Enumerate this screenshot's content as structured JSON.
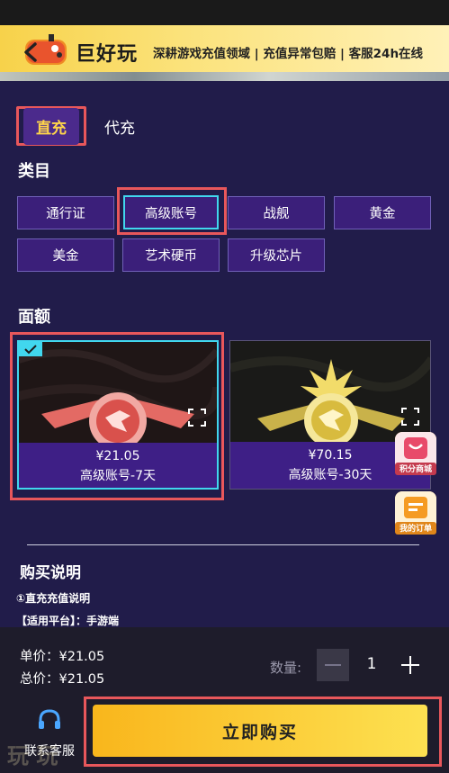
{
  "banner": {
    "brand": "巨好玩",
    "slogan": "深耕游戏充值领域 | 充值异常包赔 | 客服24h在线"
  },
  "tabs": [
    {
      "label": "直充",
      "active": true
    },
    {
      "label": "代充",
      "active": false
    }
  ],
  "category_title": "类目",
  "categories": [
    "通行证",
    "高级账号",
    "战舰",
    "黄金",
    "美金",
    "艺术硬币",
    "升级芯片"
  ],
  "selected_category": "高级账号",
  "amount_title": "面额",
  "cards": [
    {
      "price": "¥21.05",
      "name": "高级账号-7天",
      "selected": true
    },
    {
      "price": "¥70.15",
      "name": "高级账号-30天",
      "selected": false
    }
  ],
  "float_buttons": {
    "points_mall": "积分商城",
    "my_orders": "我的订单"
  },
  "description": {
    "title": "购买说明",
    "line1": "①直充充值说明",
    "line2": "【适用平台】：手游端"
  },
  "footer": {
    "unit_price": "单价：¥21.05",
    "total_price": "总价：¥21.05",
    "qty_label": "数量:",
    "qty_value": "1",
    "service_label": "联系客服",
    "buy_label": "立即购买",
    "watermark": "玩 玩"
  },
  "colors": {
    "accent": "#ffd54a",
    "highlight": "#41d7ee",
    "annotation": "#e8575b",
    "background": "#211c4a"
  }
}
